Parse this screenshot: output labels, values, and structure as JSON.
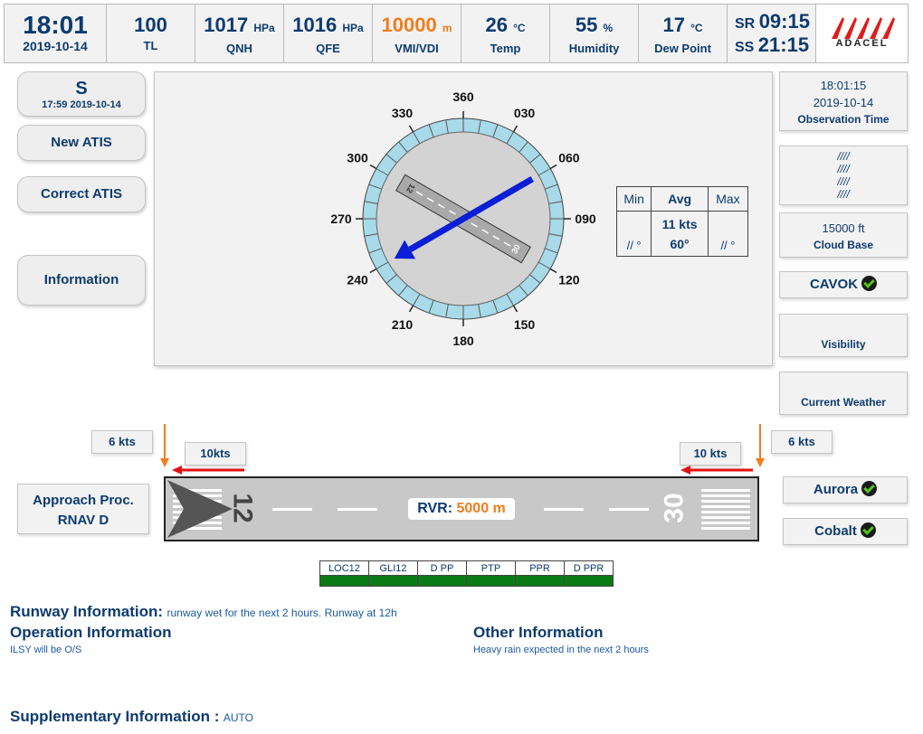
{
  "topbar": {
    "time": "18:01",
    "date": "2019-10-14",
    "tl": {
      "value": "100",
      "label": "TL"
    },
    "qnh": {
      "value": "1017",
      "unit": "HPa",
      "label": "QNH"
    },
    "qfe": {
      "value": "1016",
      "unit": "HPa",
      "label": "QFE"
    },
    "vmi": {
      "value": "10000",
      "unit": "m",
      "label": "VMI/VDI"
    },
    "temp": {
      "value": "26",
      "unit": "°C",
      "label": "Temp"
    },
    "humidity": {
      "value": "55",
      "unit": "%",
      "label": "Humidity"
    },
    "dew": {
      "value": "17",
      "unit": "°C",
      "label": "Dew Point"
    },
    "sun": {
      "sr_label": "SR",
      "sr": "09:15",
      "ss_label": "SS",
      "ss": "21:15"
    },
    "logo_text": "ADACEL"
  },
  "left": {
    "atis_letter": "S",
    "atis_time": "17:59 2019-10-14",
    "new_atis": "New ATIS",
    "correct_atis": "Correct ATIS",
    "information": "Information"
  },
  "compass": {
    "labels": [
      "360",
      "030",
      "060",
      "090",
      "120",
      "150",
      "180",
      "210",
      "240",
      "270",
      "300",
      "330"
    ],
    "wind_direction_deg": 60,
    "runway_heading_deg": 120,
    "runway_end_a": "12",
    "runway_end_b": "30"
  },
  "wind_table": {
    "headers": [
      "Min",
      "Avg",
      "Max"
    ],
    "min": "// °",
    "avg_speed": "11 kts",
    "avg_dir": "60°",
    "max": "// °"
  },
  "right": {
    "obs_time": "18:01:15",
    "obs_date": "2019-10-14",
    "obs_label": "Observation Time",
    "slashes": [
      "////",
      "////",
      "////",
      "////"
    ],
    "cloud_base_value": "15000 ft",
    "cloud_base_label": "Cloud Base",
    "cavok": "CAVOK",
    "visibility": "Visibility",
    "current_weather": "Current Weather"
  },
  "runway": {
    "left_wind": "6 kts",
    "left_head": "10kts",
    "right_head": "10 kts",
    "right_wind": "6 kts",
    "approach_line1": "Approach Proc.",
    "approach_line2": "RNAV D",
    "rvr_label": "RVR:",
    "rvr_value": "5000 m",
    "end_left": "12",
    "end_right": "30",
    "system_aurora": "Aurora",
    "system_cobalt": "Cobalt"
  },
  "ils": {
    "items": [
      "LOC12",
      "GLI12",
      "D PP",
      "PTP",
      "PPR",
      "D PPR"
    ],
    "status_color": "#0a7a14"
  },
  "info": {
    "runway_heading": "Runway Information:",
    "runway_text": "runway wet for the next 2 hours. Runway at 12h",
    "operation_heading": "Operation Information",
    "operation_text": "ILSY will be O/S",
    "other_heading": "Other Information",
    "other_text": "Heavy rain expected in the next 2 hours",
    "supp_heading": "Supplementary Information :",
    "supp_text": "AUTO"
  },
  "colors": {
    "accent_text": "#0d3b6e",
    "warning": "#f07d1e",
    "wind_arrow": "#0a1ed6",
    "compass_ring": "#a8daea",
    "headwind_arrow": "#e21010"
  }
}
